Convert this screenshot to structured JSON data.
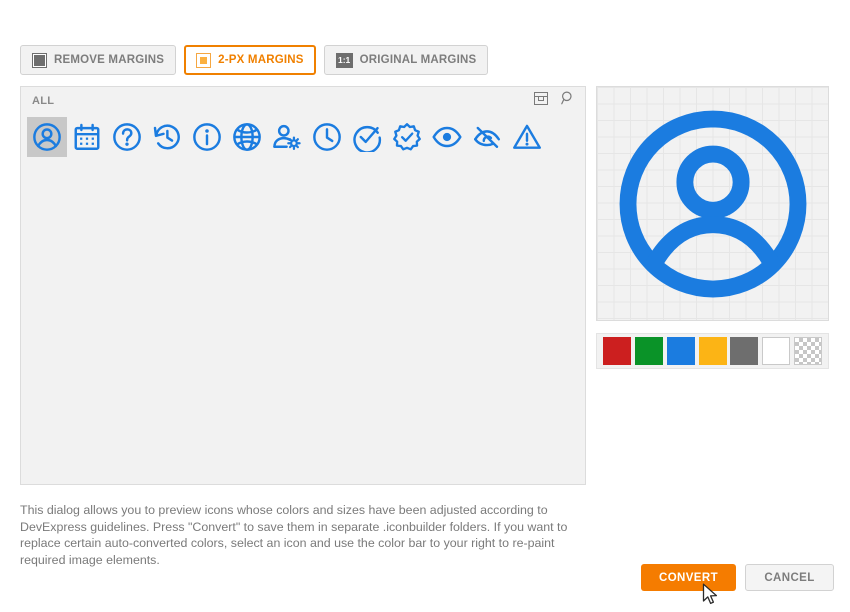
{
  "toolbar": {
    "buttons": [
      {
        "label": "REMOVE MARGINS",
        "icon": "filled-square-icon",
        "active": false
      },
      {
        "label": "2-PX MARGINS",
        "icon": "inset-square-icon",
        "active": true
      },
      {
        "label": "ORIGINAL MARGINS",
        "icon": "one-to-one-icon",
        "icon_text": "1:1",
        "active": false
      }
    ]
  },
  "icon_panel": {
    "category_label": "ALL",
    "tools": [
      {
        "name": "toggle-panel-icon"
      },
      {
        "name": "search-icon"
      }
    ],
    "icons": [
      {
        "name": "user-circle-icon",
        "selected": true
      },
      {
        "name": "calendar-icon",
        "selected": false
      },
      {
        "name": "question-circle-icon",
        "selected": false
      },
      {
        "name": "history-icon",
        "selected": false
      },
      {
        "name": "info-circle-icon",
        "selected": false
      },
      {
        "name": "globe-icon",
        "selected": false
      },
      {
        "name": "user-settings-icon",
        "selected": false
      },
      {
        "name": "clock-icon",
        "selected": false
      },
      {
        "name": "check-circle-icon",
        "selected": false
      },
      {
        "name": "verified-badge-icon",
        "selected": false
      },
      {
        "name": "eye-icon",
        "selected": false
      },
      {
        "name": "eye-off-icon",
        "selected": false
      },
      {
        "name": "warning-triangle-icon",
        "selected": false
      }
    ],
    "icon_color": "#1b7ce0",
    "selected_highlight_color": "#c8c8c8"
  },
  "preview": {
    "icon_name": "user-circle-icon",
    "icon_color": "#1b7ce0"
  },
  "color_bar": {
    "swatches": [
      {
        "name": "red-swatch",
        "color": "#cc1f1f"
      },
      {
        "name": "green-swatch",
        "color": "#0a9328"
      },
      {
        "name": "blue-swatch",
        "color": "#1b7ce0"
      },
      {
        "name": "orange-swatch",
        "color": "#fcb415"
      },
      {
        "name": "gray-swatch",
        "color": "#6e6e6e"
      },
      {
        "name": "white-swatch",
        "color": "#ffffff"
      },
      {
        "name": "transparent-swatch",
        "color": "transparent"
      }
    ]
  },
  "description": {
    "text": "This dialog allows you to preview icons whose colors and sizes have been adjusted according to DevExpress guidelines. Press \"Convert\" to save them in separate .iconbuilder folders. If you want to replace certain auto-converted colors, select an icon and use the color bar to your right to re-paint required image elements."
  },
  "footer": {
    "convert_label": "CONVERT",
    "cancel_label": "CANCEL",
    "convert_color": "#f57c00"
  }
}
